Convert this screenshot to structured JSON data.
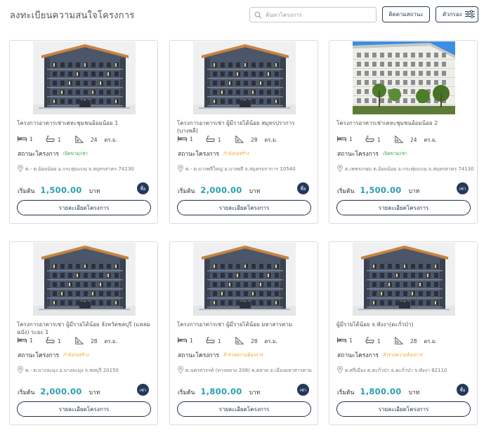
{
  "page": {
    "title": "ลงทะเบียนความสนใจโครงการ",
    "search_placeholder": "ค้นหาโครงการ",
    "follow_status_label": "ติดตามสถานะ",
    "filter_label": "ตัวกรอง"
  },
  "colors": {
    "accent": "#2b9db3",
    "navy": "#23395b",
    "status_orange": "#f5a623"
  },
  "labels": {
    "status_prefix": "สถานะโครงการ",
    "price_prefix": "เริ่มต้น",
    "currency": "บาท",
    "detail_button": "รายละเอียดโครงการ",
    "area_unit": "ตร.ม."
  },
  "projects": [
    {
      "name": "โครงการอาคารเช่าเคหะชุมชนอ้อมน้อย 1",
      "bedrooms": "1",
      "bathrooms": "1",
      "area": "24",
      "status": "เปิดขาย/เช่า",
      "address": "ต.- ต.อ้อมน้อย อ.กระทุ่มแบน จ.สมุทรสาคร 74130",
      "price": "1,500.00",
      "badge": "ซื้อ",
      "image": "building-dark"
    },
    {
      "name": "โครงการอาคารเช่า ผู้มีรายได้น้อย สมุทรปราการ (บางพลี)",
      "bedrooms": "1",
      "bathrooms": "1",
      "area": "28",
      "status": "กำลังก่อสร้าง",
      "address": "ต.- ต.บางพลีใหญ่ อ.บางพลี จ.สมุทรปราการ 10540",
      "price": "2,000.00",
      "badge": "ซื้อ",
      "image": "building-dark"
    },
    {
      "name": "โครงการอาคารเช่าเคหะชุมชนอ้อมน้อย 2",
      "bedrooms": "1",
      "bathrooms": "1",
      "area": "24",
      "status": "เปิดขาย/เช่า",
      "address": "ต.เพชรเกษม ต.อ้อมน้อย อ.กระทุ่มแบน จ.สมุทรสาคร 74130",
      "price": "1,500.00",
      "badge": "เช่า",
      "image": "building-white"
    },
    {
      "name": "โครงการอาคารเช่า ผู้มีรายได้น้อย จังหวัดชลบุรี (แหลมฉบัง) ระยะ 1",
      "bedrooms": "1",
      "bathrooms": "1",
      "area": "28",
      "status": "กำลังก่อสร้าง",
      "address": "ต.- ต.บางละมุง อ.บางละมุง จ.ชลบุรี 20150",
      "price": "2,000.00",
      "badge": "เช่า",
      "image": "building-dark"
    },
    {
      "name": "โครงการอาคารเช่า ผู้มีรายได้น้อย มหาสารคาม",
      "bedrooms": "1",
      "bathrooms": "1",
      "area": "28",
      "status": "สำรวจความต้องการ",
      "address": "ต.นครสวรรค์ (ทางหลวง 208) ต.ตลาด อ.เมืองมหาสารคาม ...",
      "price": "1,800.00",
      "badge": "เช่า",
      "image": "building-dark"
    },
    {
      "name": "ผู้มีรายได้น้อย จ.พังงา(ตะกั่วป่า)",
      "bedrooms": "1",
      "bathrooms": "1",
      "area": "28",
      "status": "สำรวจความต้องการ",
      "address": "ต.ศรีเมือง ต.ตะกั่วป่า อ.ตะกั่วป่า จ.พังงา 82110",
      "price": "1,800.00",
      "badge": "ซื้อ",
      "image": "building-dark"
    }
  ]
}
